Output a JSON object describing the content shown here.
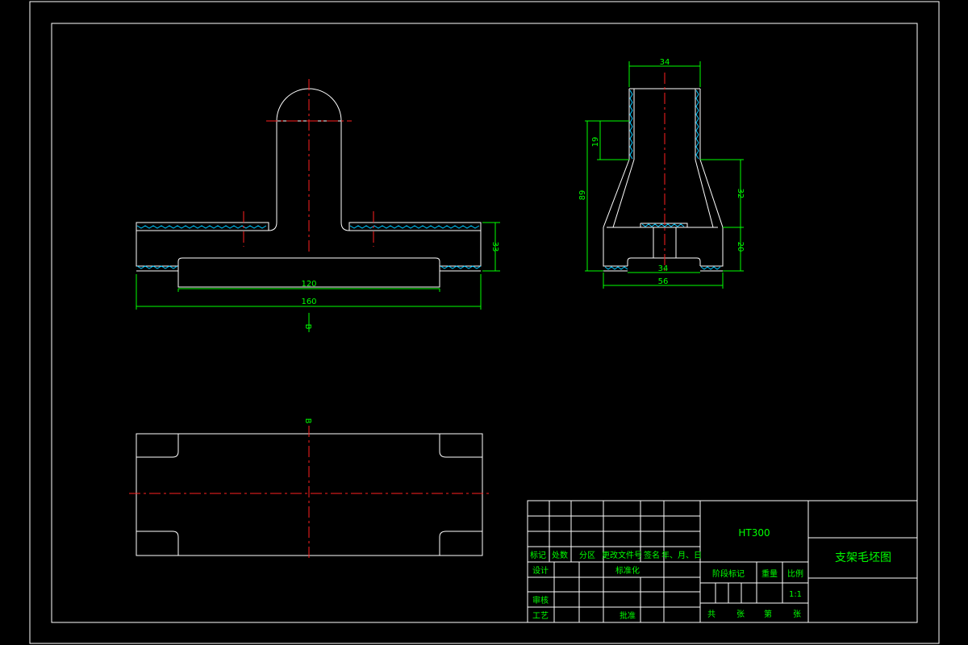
{
  "dimensions": {
    "front_inner_length": "120",
    "front_overall_length": "160",
    "front_height": "33",
    "section_mark_front": "B",
    "side_top_width": "34",
    "side_neck_height": "19",
    "side_total_height": "89",
    "side_taper_height": "32",
    "side_base_height": "20",
    "side_bottom_inner": "34",
    "side_bottom_width": "56",
    "section_mark_plan": "B"
  },
  "title_block": {
    "row_headers": [
      "标记",
      "处数",
      "分区",
      "更改文件号",
      "签名",
      "年、月、日"
    ],
    "design": "设计",
    "standardize": "标准化",
    "review": "审核",
    "process": "工艺",
    "approve": "批准",
    "stage_mark": "阶段标记",
    "weight": "重量",
    "scale_label": "比例",
    "scale_value": "1:1",
    "material": "HT300",
    "drawing_name": "支架毛坯图",
    "sheet_total_prefix": "共",
    "sheet_total_suffix": "张",
    "sheet_no_prefix": "第",
    "sheet_no_suffix": "张"
  },
  "colors": {
    "background": "#000000",
    "outline": "#ffffff",
    "centerline": "#ff2020",
    "dimension": "#00ff00",
    "hatch": "#00c8ff"
  }
}
